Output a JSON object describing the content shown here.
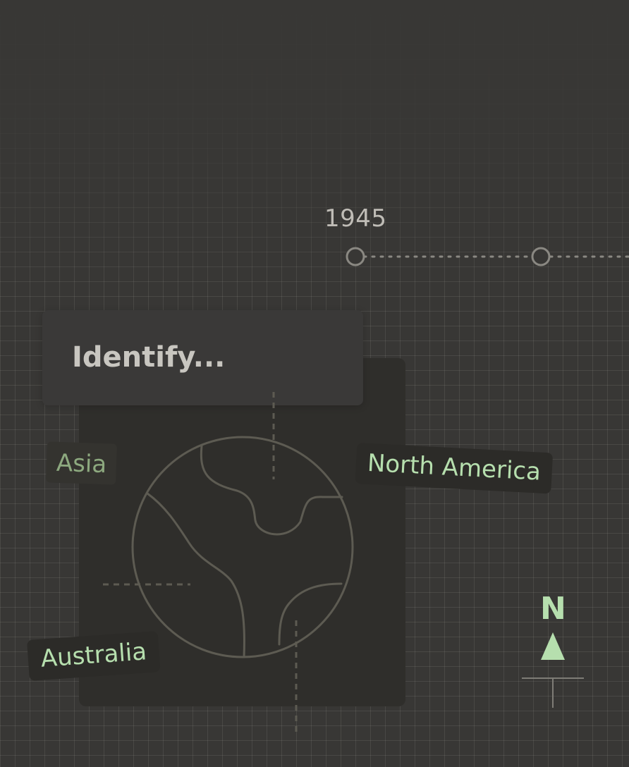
{
  "timeline": {
    "year_label": "1945"
  },
  "identify_card": {
    "title": "Identify..."
  },
  "map": {
    "labels": {
      "asia": "Asia",
      "north_america": "North America",
      "australia": "Australia"
    }
  },
  "compass": {
    "north_label": "N"
  },
  "colors": {
    "background": "#383735",
    "panel": "#2f2e2b",
    "accent_green": "#b6dfae",
    "muted_green": "#8da97f",
    "line": "#5d5b52"
  },
  "icons": {
    "globe": "globe-icon",
    "north_arrow": "north-arrow-icon"
  }
}
